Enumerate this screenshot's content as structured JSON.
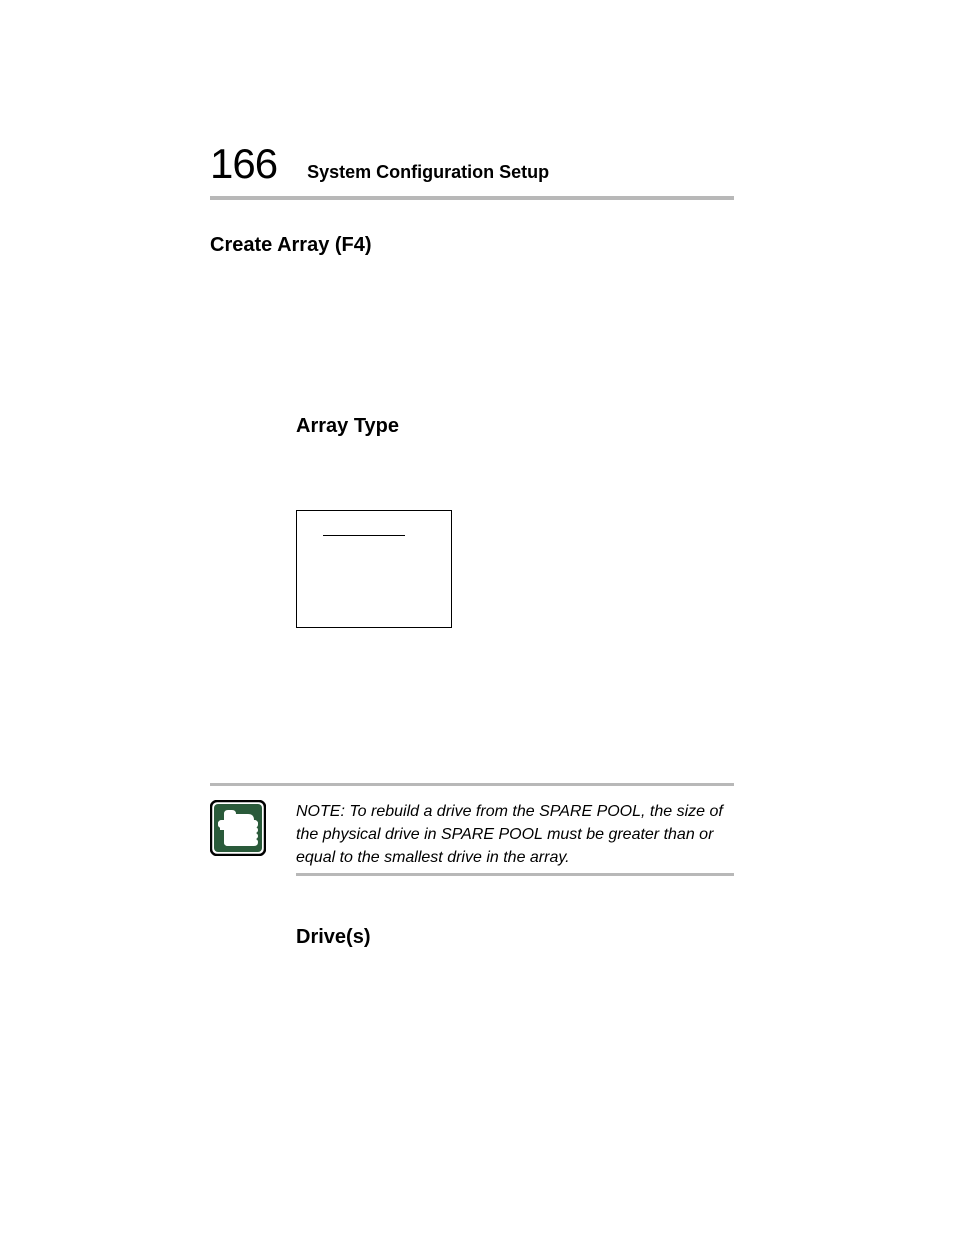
{
  "header": {
    "page_number": "166",
    "title": "System Configuration Setup"
  },
  "sections": {
    "main_heading": "Create Array (F4)",
    "sub_heading_1": "Array Type",
    "sub_heading_2": "Drive(s)"
  },
  "note": {
    "text": "NOTE: To rebuild a drive from the SPARE POOL, the size of the physical drive in SPARE POOL must be greater than or equal to the smallest drive in the array."
  }
}
